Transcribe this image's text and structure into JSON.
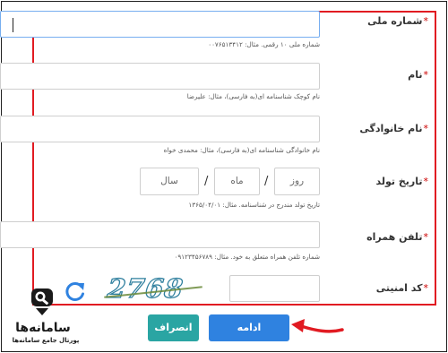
{
  "form": {
    "required_mark": "*",
    "fields": {
      "national_code": {
        "label": "شماره ملی",
        "hint": "شماره ملی ۱۰ رقمی. مثال: ۰۰۷۶۵۱۳۴۱۲",
        "value": ""
      },
      "first_name": {
        "label": "نام",
        "hint": "نام کوچک شناسنامه ای(به فارسی)، مثال: علیرضا",
        "value": ""
      },
      "last_name": {
        "label": "نام خانوادگی",
        "hint": "نام خانوادگی شناسنامه ای(به فارسی)، مثال: محمدی خواه",
        "value": ""
      },
      "birth_date": {
        "label": "تاریخ تولد",
        "hint": "تاریخ تولد مندرج در شناسنامه. مثال: ۱۳۶۵/۰۴/۰۱",
        "day_placeholder": "روز",
        "month_placeholder": "ماه",
        "year_placeholder": "سال",
        "separator": "/"
      },
      "mobile": {
        "label": "تلفن همراه",
        "hint": "شماره تلفن همراه متعلق به خود. مثال: ۰۹۱۲۳۴۵۶۷۸۹",
        "value": ""
      },
      "captcha": {
        "label": "کد امنیتی",
        "value": "",
        "image_text": "2768"
      }
    }
  },
  "buttons": {
    "next": "ادامه",
    "cancel": "انصراف"
  },
  "brand": {
    "name": "سامانه‌ها",
    "tagline": "پورتال جامع سامانه‌ها"
  },
  "colors": {
    "highlight_border": "#e11b22",
    "next_button": "#2f82e0",
    "cancel_button": "#2aa5a3",
    "focus_border": "#77aef0"
  },
  "icons": [
    "refresh-icon",
    "arrow-icon",
    "logo-icon"
  ]
}
